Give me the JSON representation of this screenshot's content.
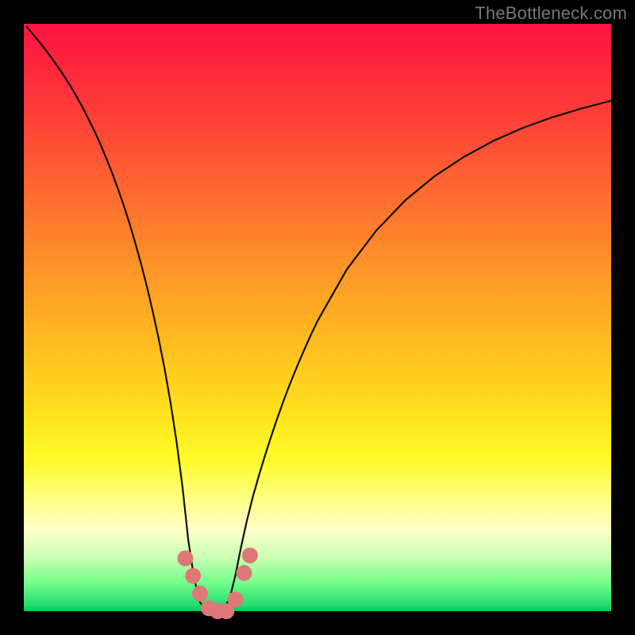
{
  "watermark": "TheBottleneck.com",
  "colors": {
    "background": "#000000",
    "curve": "#111111",
    "marker": "#de7878"
  },
  "chart_data": {
    "type": "line",
    "title": "",
    "xlabel": "",
    "ylabel": "",
    "xlim": [
      0,
      100
    ],
    "ylim": [
      0,
      100
    ],
    "x": [
      0.5,
      1,
      2,
      3,
      4,
      5,
      6,
      7,
      8,
      9,
      10,
      11,
      12,
      13,
      14,
      15,
      16,
      17,
      18,
      19,
      20,
      21,
      22,
      23,
      24,
      25,
      26,
      27,
      28,
      29,
      30,
      31,
      32,
      33,
      34,
      35,
      36,
      37,
      38,
      39,
      40,
      41,
      42,
      43,
      44,
      45,
      46,
      47,
      48,
      49,
      50,
      55,
      60,
      65,
      70,
      75,
      80,
      85,
      90,
      95,
      100
    ],
    "values": [
      99.5,
      98.9,
      97.7,
      96.5,
      95.2,
      93.8,
      92.4,
      90.9,
      89.3,
      87.6,
      85.8,
      83.8,
      81.8,
      79.6,
      77.2,
      74.7,
      72,
      69.1,
      66,
      62.6,
      59,
      55.1,
      50.8,
      46.2,
      41.1,
      35.4,
      28.9,
      21.3,
      12.1,
      5.5,
      1.5,
      0.3,
      0,
      0,
      0.5,
      2,
      6,
      11,
      15.5,
      19.5,
      23,
      26.3,
      29.4,
      32.4,
      35.2,
      37.9,
      40.4,
      42.8,
      45.1,
      47.3,
      49.4,
      58.2,
      64.8,
      70,
      74.1,
      77.4,
      80.1,
      82.3,
      84.1,
      85.6,
      86.9
    ],
    "markers": [
      {
        "x": 27.5,
        "y": 9
      },
      {
        "x": 28.8,
        "y": 6
      },
      {
        "x": 30,
        "y": 3
      },
      {
        "x": 31.5,
        "y": 0.5
      },
      {
        "x": 33,
        "y": 0
      },
      {
        "x": 34.5,
        "y": 0
      },
      {
        "x": 36,
        "y": 2
      },
      {
        "x": 37.5,
        "y": 6.5
      },
      {
        "x": 38.5,
        "y": 9.5
      }
    ],
    "grid": false,
    "legend": false,
    "note": "Values read off gradient position; y=0 is bottom (green), y=100 is top (red)."
  }
}
